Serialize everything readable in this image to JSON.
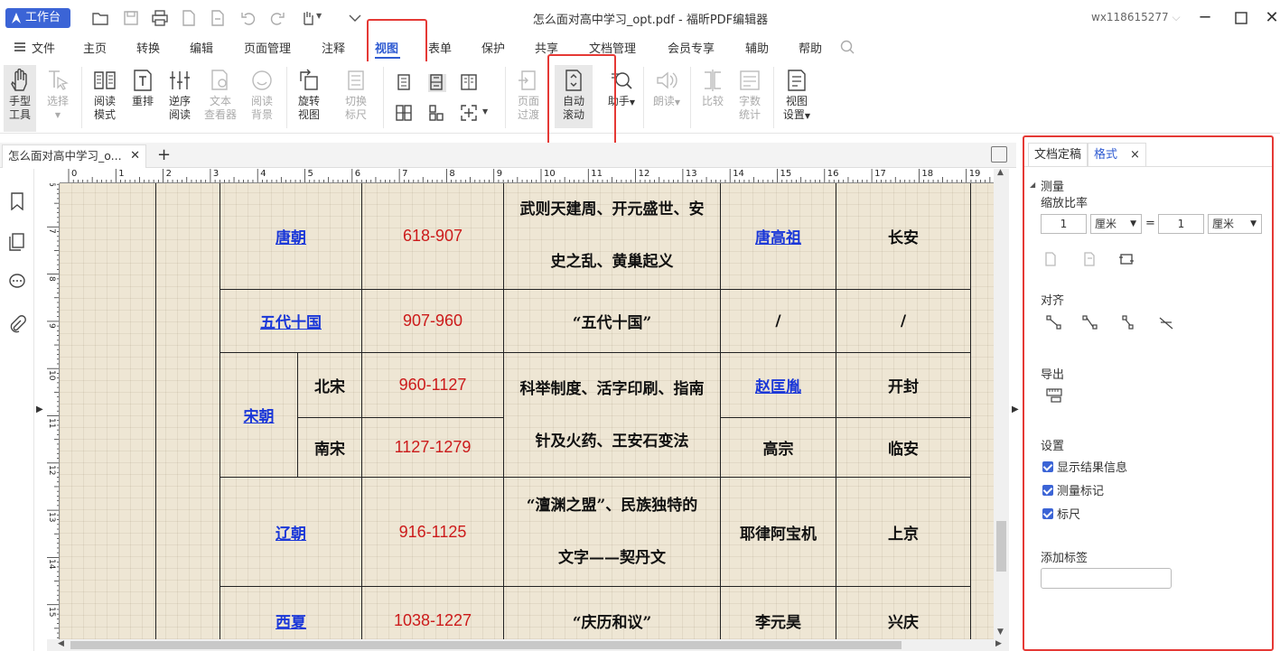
{
  "titlebar": {
    "workbench_label": "工作台",
    "title": "怎么面对高中学习_opt.pdf - 福昕PDF编辑器",
    "user": "wx118615277"
  },
  "menu": {
    "items": [
      "文件",
      "主页",
      "转换",
      "编辑",
      "页面管理",
      "注释",
      "视图",
      "表单",
      "保护",
      "共享",
      "文档管理",
      "会员专享",
      "辅助",
      "帮助"
    ],
    "active": "视图"
  },
  "ribbon": {
    "hand_tool": [
      "手型",
      "工具"
    ],
    "select": "选择",
    "read_mode": [
      "阅读",
      "模式"
    ],
    "reflow": "重排",
    "reverse_read": [
      "逆序",
      "阅读"
    ],
    "text_viewer": [
      "文本",
      "查看器"
    ],
    "read_bg": [
      "阅读",
      "背景"
    ],
    "rotate_view": [
      "旋转",
      "视图"
    ],
    "toggle_ruler": [
      "切换",
      "标尺"
    ],
    "page_transition": [
      "页面",
      "过渡"
    ],
    "auto_scroll": [
      "自动",
      "滚动"
    ],
    "assistant": "助手",
    "read_aloud": "朗读",
    "compare": "比较",
    "word_count": [
      "字数",
      "统计"
    ],
    "view_settings": [
      "视图",
      "设置"
    ]
  },
  "tabs": {
    "doc_tab": "怎么面对高中学习_o...",
    "plus": "+"
  },
  "ruler": {
    "h_numbers": [
      "0",
      "1",
      "2",
      "3",
      "4",
      "5",
      "6",
      "7",
      "8",
      "9",
      "10",
      "11",
      "12",
      "13",
      "14",
      "15",
      "16",
      "17",
      "18",
      "19"
    ],
    "v_numbers": [
      "6",
      "7",
      "8",
      "9",
      "10",
      "11",
      "12",
      "13",
      "14",
      "15"
    ]
  },
  "table": {
    "tang": {
      "name": "唐朝",
      "years": "618-907",
      "events": [
        "武则天建周、开元盛世、安",
        "史之乱、黄巢起义"
      ],
      "founder": "唐高祖",
      "capital": "长安"
    },
    "wudai": {
      "name": "五代十国",
      "years": "907-960",
      "events": "“五代十国”",
      "founder": "/",
      "capital": "/"
    },
    "song": {
      "name": "宋朝",
      "events": [
        "科举制度、活字印刷、指南",
        "针及火药、王安石变法"
      ],
      "north": {
        "name": "北宋",
        "years": "960-1127",
        "founder": "赵匡胤",
        "capital": "开封"
      },
      "south": {
        "name": "南宋",
        "years": "1127-1279",
        "founder": "高宗",
        "capital": "临安"
      }
    },
    "liao": {
      "name": "辽朝",
      "years": "916-1125",
      "events": [
        "“澶渊之盟”、民族独特的",
        "文字——契丹文"
      ],
      "founder": "耶律阿宝机",
      "capital": "上京"
    },
    "xixia": {
      "name": "西夏",
      "years": "1038-1227",
      "events": "“庆历和议”",
      "founder": "李元昊",
      "capital": "兴庆"
    }
  },
  "panel": {
    "tab1": "文档定稿",
    "tab2": "格式",
    "close": "×",
    "section_measure": "测量",
    "scale_label": "缩放比率",
    "scale_left_value": "1",
    "scale_left_unit": "厘米",
    "equals": "=",
    "scale_right_value": "1",
    "scale_right_unit": "厘米",
    "align_label": "对齐",
    "export_label": "导出",
    "settings_label": "设置",
    "check_show_result": "显示结果信息",
    "check_measure_mark": "测量标记",
    "check_ruler": "标尺",
    "add_tag_label": "添加标签",
    "add_tag_value": ""
  },
  "colors": {
    "accent": "#2f5bd2",
    "highlight_box": "#e53935",
    "link": "#1a37d8",
    "year_red": "#cc1b1b"
  }
}
